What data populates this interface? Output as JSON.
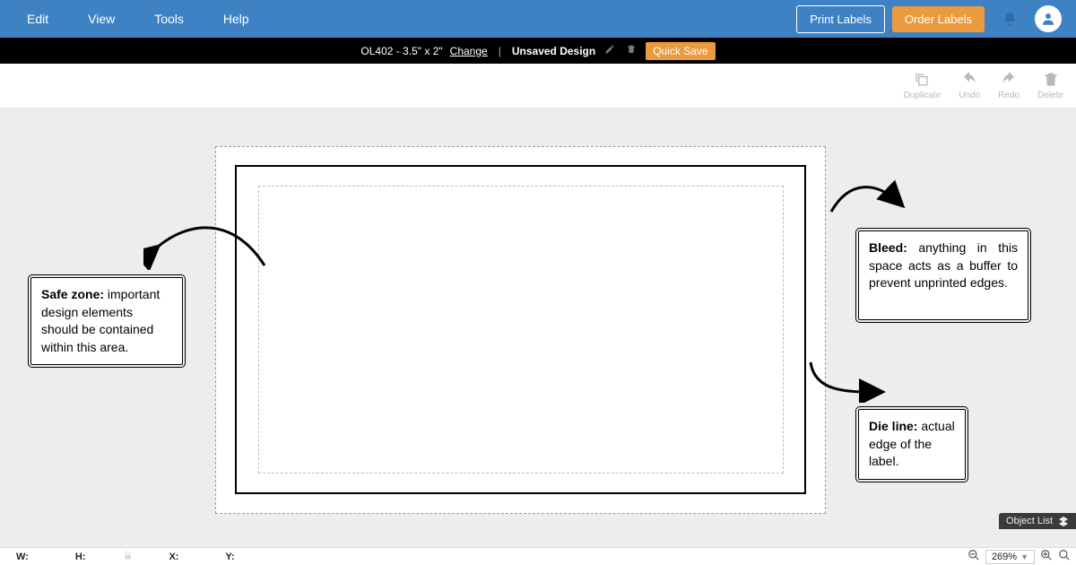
{
  "menu": {
    "items": [
      "Edit",
      "View",
      "Tools",
      "Help"
    ]
  },
  "header": {
    "print_btn": "Print Labels",
    "order_btn": "Order Labels"
  },
  "blackbar": {
    "label_id": "OL402 - 3.5\" x 2\"",
    "change": "Change",
    "design_name": "Unsaved Design",
    "quick_save": "Quick Save"
  },
  "toolstrip": {
    "duplicate": "Duplicate",
    "undo": "Undo",
    "redo": "Redo",
    "delete": "Delete"
  },
  "callouts": {
    "safe_title": "Safe zone:",
    "safe_text": " important design elements should be contained within this area.",
    "bleed_title": "Bleed:",
    "bleed_text": " anything in this space acts as a buffer to prevent unprinted edges.",
    "die_title": "Die line:",
    "die_text": " actual edge of the label."
  },
  "status": {
    "w_label": "W:",
    "h_label": "H:",
    "x_label": "X:",
    "y_label": "Y:",
    "w_value": "",
    "h_value": "",
    "x_value": "",
    "y_value": "",
    "zoom": "269%"
  },
  "object_list": {
    "label": "Object List"
  }
}
